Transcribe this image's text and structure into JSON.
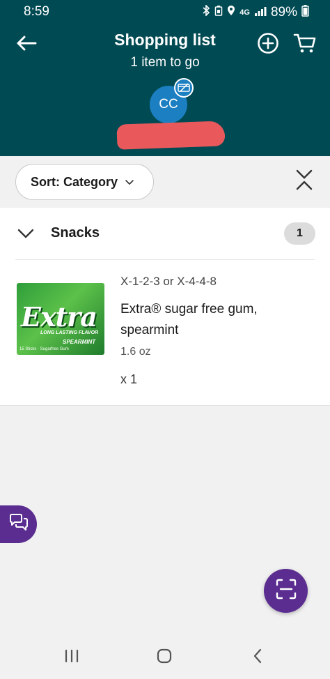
{
  "status_bar": {
    "time": "8:59",
    "network": "4G",
    "battery": "89%"
  },
  "header": {
    "title": "Shopping list",
    "subtitle": "1 item to go",
    "avatar_initials": "CC",
    "background_color": "#004a53"
  },
  "toolbar": {
    "sort_label": "Sort: Category"
  },
  "sections": [
    {
      "title": "Snacks",
      "count": "1",
      "items": [
        {
          "location": "X-1-2-3 or X-4-4-8",
          "name": "Extra® sugar free gum, spearmint",
          "size": "1.6 oz",
          "quantity": "x 1",
          "image_brand": "Extra",
          "image_tagline": "LONG LASTING FLAVOR",
          "image_variant": "SPEARMINT",
          "image_count": "15 Sticks · Sugarfree Gum"
        }
      ]
    }
  ],
  "colors": {
    "accent": "#5b2d90",
    "avatar": "#1b7fc1"
  }
}
